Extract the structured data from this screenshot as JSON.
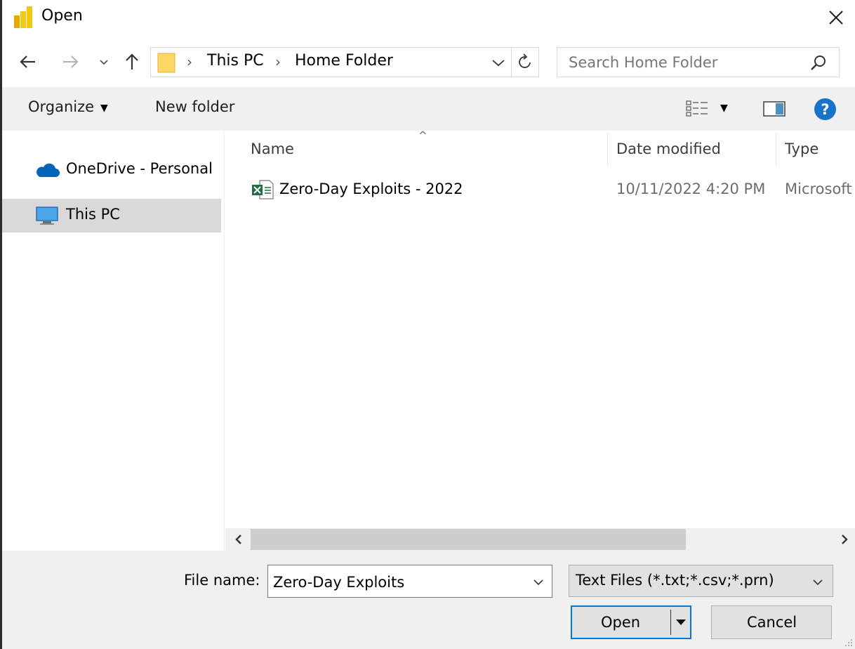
{
  "window": {
    "title": "Open",
    "app_icon": "power-bi-icon",
    "close_icon": "close-icon"
  },
  "nav_buttons": {
    "back_icon": "arrow-left-icon",
    "forward_icon": "arrow-right-icon",
    "recent_icon": "chevron-down-icon",
    "up_icon": "arrow-up-icon"
  },
  "address": {
    "folder_icon": "folder-icon",
    "crumbs": [
      "This PC",
      "Home Folder"
    ],
    "separator": "›",
    "refresh_icon": "refresh-icon"
  },
  "search": {
    "placeholder": "Search Home Folder",
    "value": "",
    "icon": "search-icon"
  },
  "toolbar": {
    "organize_label": "Organize",
    "new_folder_label": "New folder",
    "view_icon": "view-options-icon",
    "preview_pane_icon": "preview-pane-icon",
    "help_icon": "help-icon",
    "help_glyph": "?"
  },
  "sidebar": {
    "items": [
      {
        "label": "OneDrive - Personal",
        "icon": "cloud-icon",
        "selected": false
      },
      {
        "label": "This PC",
        "icon": "monitor-icon",
        "selected": true
      }
    ]
  },
  "columns": [
    "Name",
    "Date modified",
    "Type"
  ],
  "files": [
    {
      "name": "Zero-Day Exploits - 2022",
      "date_modified": "10/11/2022 4:20 PM",
      "type": "Microsoft Excel Worksheet",
      "icon": "excel-file-icon"
    }
  ],
  "footer": {
    "file_name_label": "File name:",
    "file_name_value": "Zero-Day Exploits",
    "file_type_filter": "Text Files (*.txt;*.csv;*.prn)",
    "open_label": "Open",
    "cancel_label": "Cancel"
  },
  "colors": {
    "accent": "#0078d7",
    "selected_bg": "#d9d9d9",
    "toolbar_bg": "#f0f0f0",
    "excel_green": "#1d6f42",
    "folder_yellow": "#ffd769",
    "help_blue": "#1a73c8"
  }
}
